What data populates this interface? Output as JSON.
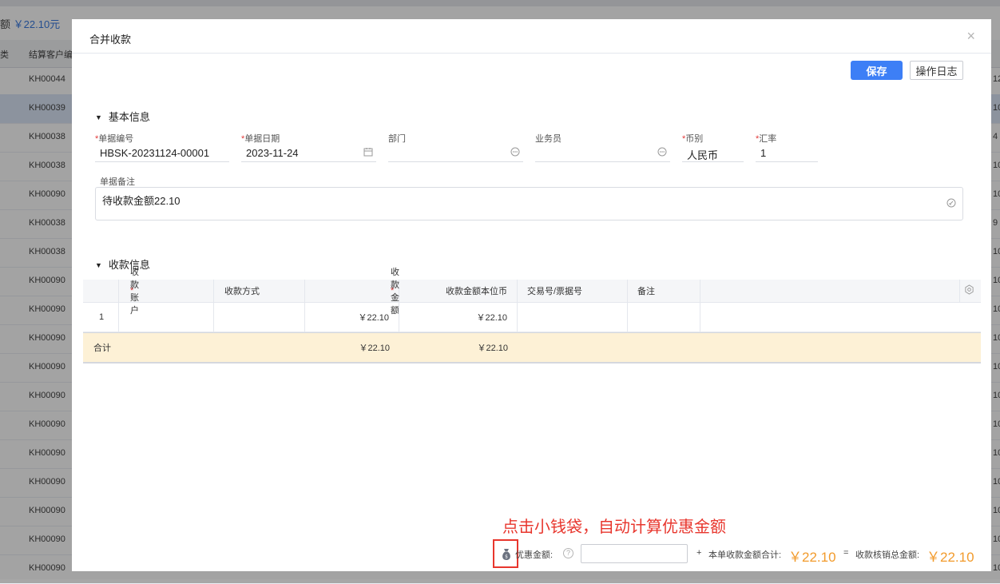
{
  "background": {
    "summary_prefix": "额",
    "summary_amount": "￥22.10元",
    "columns": [
      "类",
      "结算客户编"
    ],
    "rows": [
      "KH00044",
      "KH00039",
      "KH00038",
      "KH00038",
      "KH00090",
      "KH00038",
      "KH00038",
      "KH00090",
      "KH00090",
      "KH00090",
      "KH00090",
      "KH00090",
      "KH00090",
      "KH00090",
      "KH00090",
      "KH00090",
      "KH00090",
      "KH00090"
    ],
    "row_tails": [
      "12",
      "10",
      "4",
      "10",
      "10",
      "9",
      "10",
      "10",
      "10",
      "10",
      "10",
      "10",
      "10",
      "10",
      "10",
      "10",
      "10",
      "10"
    ]
  },
  "modal": {
    "title": "合并收款",
    "close_icon": "×",
    "toolbar": {
      "save_label": "保存",
      "log_label": "操作日志"
    },
    "basic_section": "基本信息",
    "fields": {
      "doc_no": {
        "label": "单据编号",
        "required": "*",
        "value": "HBSK-20231124-00001"
      },
      "doc_date": {
        "label": "单据日期",
        "required": "*",
        "value": "2023-11-24"
      },
      "department": {
        "label": "部门",
        "value": ""
      },
      "salesman": {
        "label": "业务员",
        "value": ""
      },
      "currency": {
        "label": "币别",
        "required": "*",
        "value": "人民币"
      },
      "rate": {
        "label": "汇率",
        "required": "*",
        "value": "1"
      },
      "remark": {
        "label": "单据备注",
        "value": "待收款金额22.10"
      }
    },
    "receipt_section": "收款信息",
    "grid": {
      "headers": {
        "account": "收款账户",
        "method": "收款方式",
        "amount": "收款金额",
        "local_amount": "收款金额本位币",
        "txn_no": "交易号/票据号",
        "note": "备注"
      },
      "required_mark": "*",
      "rows": [
        {
          "index": "1",
          "account": "",
          "method": "",
          "amount": "￥22.10",
          "local_amount": "￥22.10",
          "txn_no": "",
          "note": ""
        }
      ],
      "total": {
        "label": "合计",
        "amount": "￥22.10",
        "local_amount": "￥22.10"
      }
    },
    "footer": {
      "hint": "点击小钱袋，自动计算优惠金额",
      "discount_label": "优惠金额:",
      "help_icon": "?",
      "discount_value": "",
      "plus": "+",
      "total_label": "本单收款金额合计:",
      "total_amount": "￥22.10",
      "equals": "=",
      "writeoff_label": "收款核销总金额:",
      "writeoff_amount": "￥22.10"
    }
  },
  "colors": {
    "primary": "#3d7ff6",
    "required": "#e23b3b",
    "hint_red": "#e8362d",
    "amount_orange": "#f29b2c",
    "total_row_bg": "#fdf1d6"
  },
  "icons": [
    "close-icon",
    "calendar-icon",
    "ellipsis-icon",
    "remark-edit-icon",
    "gear-icon",
    "money-bag-icon",
    "help-icon",
    "triangle-down-icon"
  ]
}
